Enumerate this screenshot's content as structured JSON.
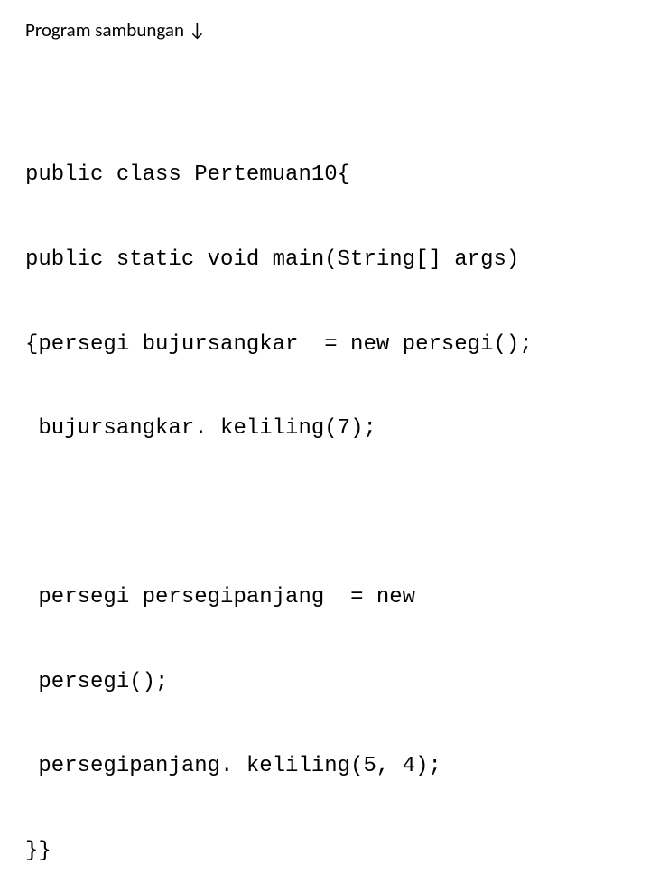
{
  "heading": "Program sambungan ↓",
  "code": {
    "line1": "public class Pertemuan10{",
    "line2": "public static void main(String[] args)",
    "line3": "{persegi bujursangkar  = new persegi();",
    "line4": " bujursangkar. keliling(7);",
    "line5": " persegi persegipanjang  = new",
    "line6": " persegi();",
    "line7": " persegipanjang. keliling(5, 4);",
    "line8": "}}"
  }
}
